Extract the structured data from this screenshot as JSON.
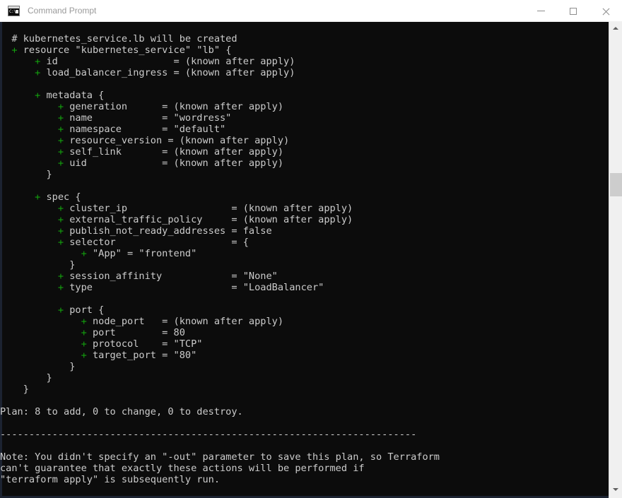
{
  "window": {
    "title": "Command Prompt",
    "icon": "console-icon",
    "icon_prompt_text": "C:\\",
    "controls": {
      "minimize": "Minimize",
      "maximize": "Maximize",
      "close": "Close"
    },
    "background_color": "#0c0c0c",
    "text_color": "#cccccc",
    "accent_color": "#13a10e"
  },
  "scrollbar": {
    "up_arrow": "scroll-up",
    "down_arrow": "scroll-down",
    "thumb": "scroll-thumb"
  },
  "terminal": {
    "lines": [
      [
        {
          "t": "  # kubernetes_service.lb will be created"
        }
      ],
      [
        {
          "t": "  "
        },
        {
          "t": "+",
          "c": "plus"
        },
        {
          "t": " resource \"kubernetes_service\" \"lb\" {"
        }
      ],
      [
        {
          "t": "      "
        },
        {
          "t": "+",
          "c": "plus"
        },
        {
          "t": " id                    = (known after apply)"
        }
      ],
      [
        {
          "t": "      "
        },
        {
          "t": "+",
          "c": "plus"
        },
        {
          "t": " load_balancer_ingress = (known after apply)"
        }
      ],
      [
        {
          "t": ""
        }
      ],
      [
        {
          "t": "      "
        },
        {
          "t": "+",
          "c": "plus"
        },
        {
          "t": " metadata {"
        }
      ],
      [
        {
          "t": "          "
        },
        {
          "t": "+",
          "c": "plus"
        },
        {
          "t": " generation      = (known after apply)"
        }
      ],
      [
        {
          "t": "          "
        },
        {
          "t": "+",
          "c": "plus"
        },
        {
          "t": " name            = \"wordress\""
        }
      ],
      [
        {
          "t": "          "
        },
        {
          "t": "+",
          "c": "plus"
        },
        {
          "t": " namespace       = \"default\""
        }
      ],
      [
        {
          "t": "          "
        },
        {
          "t": "+",
          "c": "plus"
        },
        {
          "t": " resource_version = (known after apply)"
        }
      ],
      [
        {
          "t": "          "
        },
        {
          "t": "+",
          "c": "plus"
        },
        {
          "t": " self_link       = (known after apply)"
        }
      ],
      [
        {
          "t": "          "
        },
        {
          "t": "+",
          "c": "plus"
        },
        {
          "t": " uid             = (known after apply)"
        }
      ],
      [
        {
          "t": "        }"
        }
      ],
      [
        {
          "t": ""
        }
      ],
      [
        {
          "t": "      "
        },
        {
          "t": "+",
          "c": "plus"
        },
        {
          "t": " spec {"
        }
      ],
      [
        {
          "t": "          "
        },
        {
          "t": "+",
          "c": "plus"
        },
        {
          "t": " cluster_ip                  = (known after apply)"
        }
      ],
      [
        {
          "t": "          "
        },
        {
          "t": "+",
          "c": "plus"
        },
        {
          "t": " external_traffic_policy     = (known after apply)"
        }
      ],
      [
        {
          "t": "          "
        },
        {
          "t": "+",
          "c": "plus"
        },
        {
          "t": " publish_not_ready_addresses = false"
        }
      ],
      [
        {
          "t": "          "
        },
        {
          "t": "+",
          "c": "plus"
        },
        {
          "t": " selector                    = {"
        }
      ],
      [
        {
          "t": "              "
        },
        {
          "t": "+",
          "c": "plus"
        },
        {
          "t": " \"App\" = \"frontend\""
        }
      ],
      [
        {
          "t": "            }"
        }
      ],
      [
        {
          "t": "          "
        },
        {
          "t": "+",
          "c": "plus"
        },
        {
          "t": " session_affinity            = \"None\""
        }
      ],
      [
        {
          "t": "          "
        },
        {
          "t": "+",
          "c": "plus"
        },
        {
          "t": " type                        = \"LoadBalancer\""
        }
      ],
      [
        {
          "t": ""
        }
      ],
      [
        {
          "t": "          "
        },
        {
          "t": "+",
          "c": "plus"
        },
        {
          "t": " port {"
        }
      ],
      [
        {
          "t": "              "
        },
        {
          "t": "+",
          "c": "plus"
        },
        {
          "t": " node_port   = (known after apply)"
        }
      ],
      [
        {
          "t": "              "
        },
        {
          "t": "+",
          "c": "plus"
        },
        {
          "t": " port        = 80"
        }
      ],
      [
        {
          "t": "              "
        },
        {
          "t": "+",
          "c": "plus"
        },
        {
          "t": " protocol    = \"TCP\""
        }
      ],
      [
        {
          "t": "              "
        },
        {
          "t": "+",
          "c": "plus"
        },
        {
          "t": " target_port = \"80\""
        }
      ],
      [
        {
          "t": "            }"
        }
      ],
      [
        {
          "t": "        }"
        }
      ],
      [
        {
          "t": "    }"
        }
      ],
      [
        {
          "t": ""
        }
      ],
      [
        {
          "t": "Plan: 8 to add, 0 to change, 0 to destroy."
        }
      ],
      [
        {
          "t": ""
        }
      ],
      [
        {
          "t": "------------------------------------------------------------------------"
        }
      ],
      [
        {
          "t": ""
        }
      ],
      [
        {
          "t": "Note: You didn't specify an \"-out\" parameter to save this plan, so Terraform"
        }
      ],
      [
        {
          "t": "can't guarantee that exactly these actions will be performed if"
        }
      ],
      [
        {
          "t": "\"terraform apply\" is subsequently run."
        }
      ],
      [
        {
          "t": ""
        }
      ]
    ],
    "plan_summary": "Plan: 8 to add, 0 to change, 0 to destroy.",
    "resource_name": "kubernetes_service.lb",
    "counts": {
      "add": 8,
      "change": 0,
      "destroy": 0
    }
  }
}
